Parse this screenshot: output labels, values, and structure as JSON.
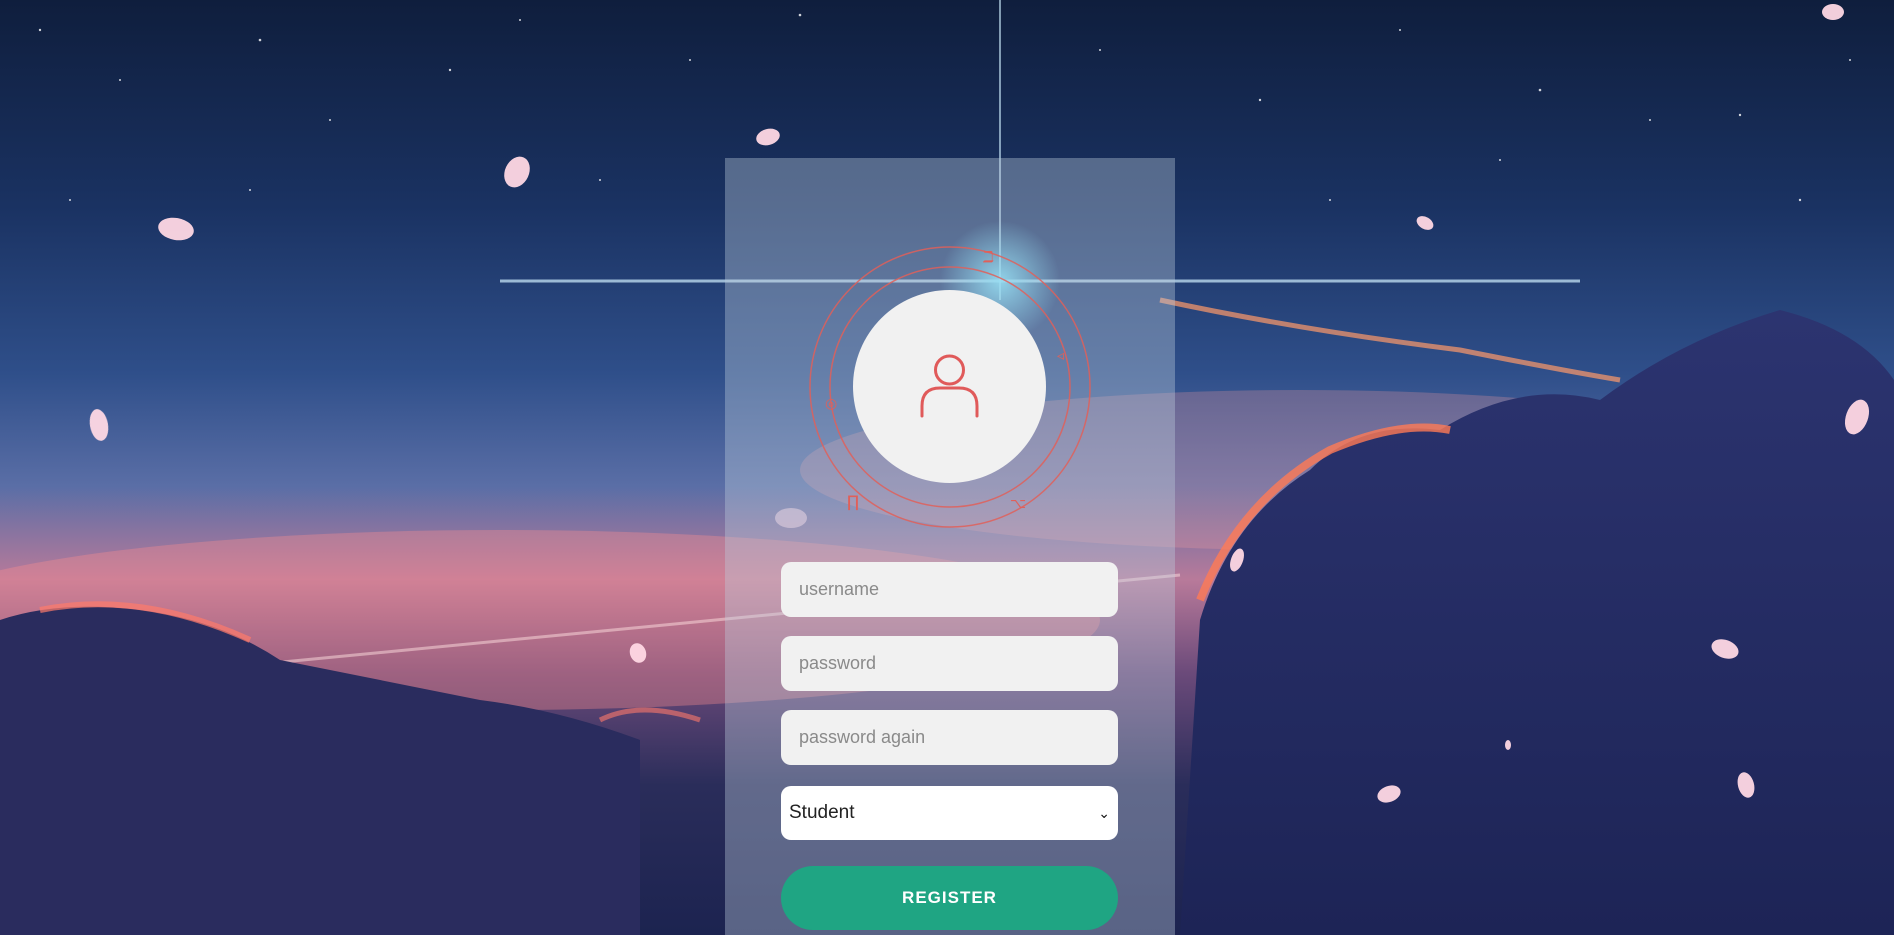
{
  "form": {
    "username_placeholder": "username",
    "password_placeholder": "password",
    "password_again_placeholder": "password again",
    "role_selected": "Student",
    "register_label": "REGISTER"
  },
  "colors": {
    "accent": "#1fa583",
    "avatar_icon": "#e05a5a",
    "field_bg": "#f1f1f1"
  },
  "icons": {
    "avatar": "user-icon",
    "dropdown": "chevron-down-icon"
  }
}
